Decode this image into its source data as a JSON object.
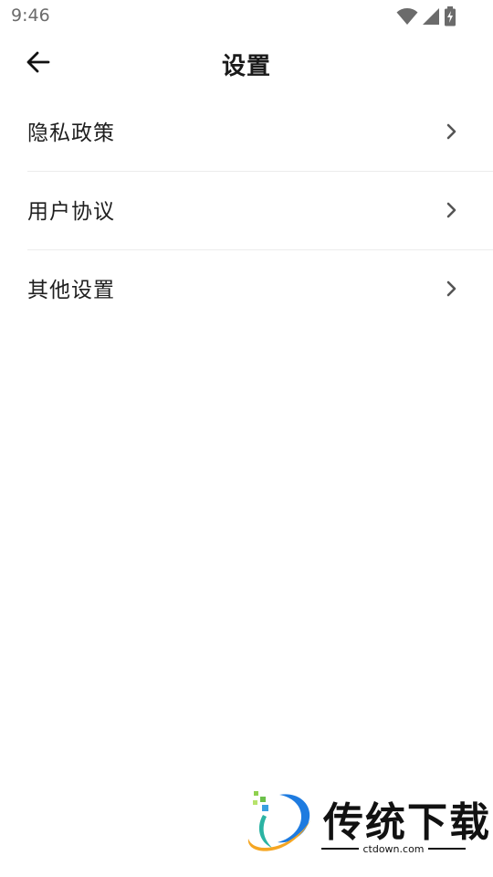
{
  "status_bar": {
    "time": "9:46",
    "icons": [
      "wifi-icon",
      "cell-signal-icon",
      "battery-charging-icon"
    ]
  },
  "header": {
    "back_icon": "arrow-left-icon",
    "title": "设置"
  },
  "settings": {
    "items": [
      {
        "label": "隐私政策",
        "icon": "chevron-right-icon"
      },
      {
        "label": "用户协议",
        "icon": "chevron-right-icon"
      },
      {
        "label": "其他设置",
        "icon": "chevron-right-icon"
      }
    ]
  },
  "watermark": {
    "brand": "传统下载",
    "url": "ctdown.com"
  },
  "colors": {
    "background": "#ffffff",
    "text": "#1a1a1a",
    "divider": "#ececec",
    "chevron": "#555555",
    "status": "#6b6b6b"
  }
}
